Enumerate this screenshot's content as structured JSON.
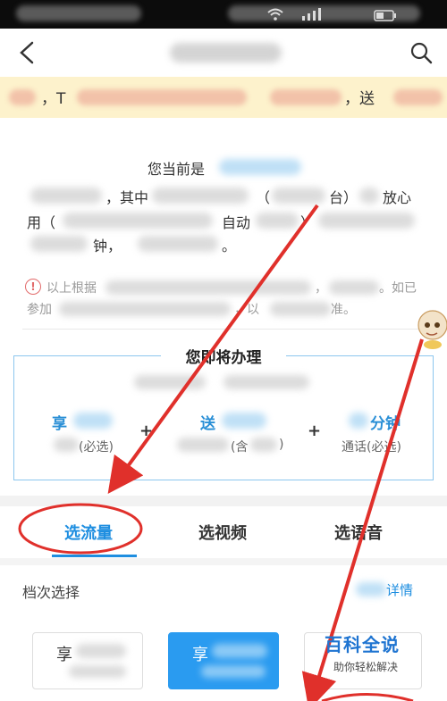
{
  "nav": {
    "back_icon": "chevron-left-icon",
    "search_icon": "search-icon"
  },
  "notice": {
    "part1": "，T",
    "part2": "，送"
  },
  "info": {
    "line1": "您当前是",
    "line2_a": "，其中",
    "line2_b": "（",
    "line2_c": "台）",
    "line2_d": "放心",
    "line3_a": "用（",
    "line3_b": "自动",
    "line3_c": "）",
    "line4_a": "钟，",
    "line4_b": "。"
  },
  "tip": {
    "icon": "alert-circle-icon",
    "line1_a": "以上根据",
    "line1_b": "，",
    "line1_c": "。如已",
    "line2_a": "参加",
    "line2_b": "，以",
    "line2_c": "准。"
  },
  "package": {
    "heading": "您即将办理",
    "benefit1_title": "享",
    "benefit1_sub": "(必选)",
    "benefit2_title": "送",
    "benefit2_sub": "(含",
    "benefit2_close": ")",
    "benefit3_title": "分钟",
    "benefit3_sub": "通话(必选)",
    "plus": "+"
  },
  "tabs": [
    "选流量",
    "选视频",
    "选语音"
  ],
  "tier": {
    "title": "档次选择",
    "detail": "详情",
    "card1": "享",
    "card2": "享"
  },
  "watermark": {
    "title": "百科全说",
    "subtitle": "助你轻松解决"
  },
  "colors": {
    "accent": "#1e8ee0",
    "annotation": "#e0302b",
    "notice_bg": "#fdf2cc"
  }
}
